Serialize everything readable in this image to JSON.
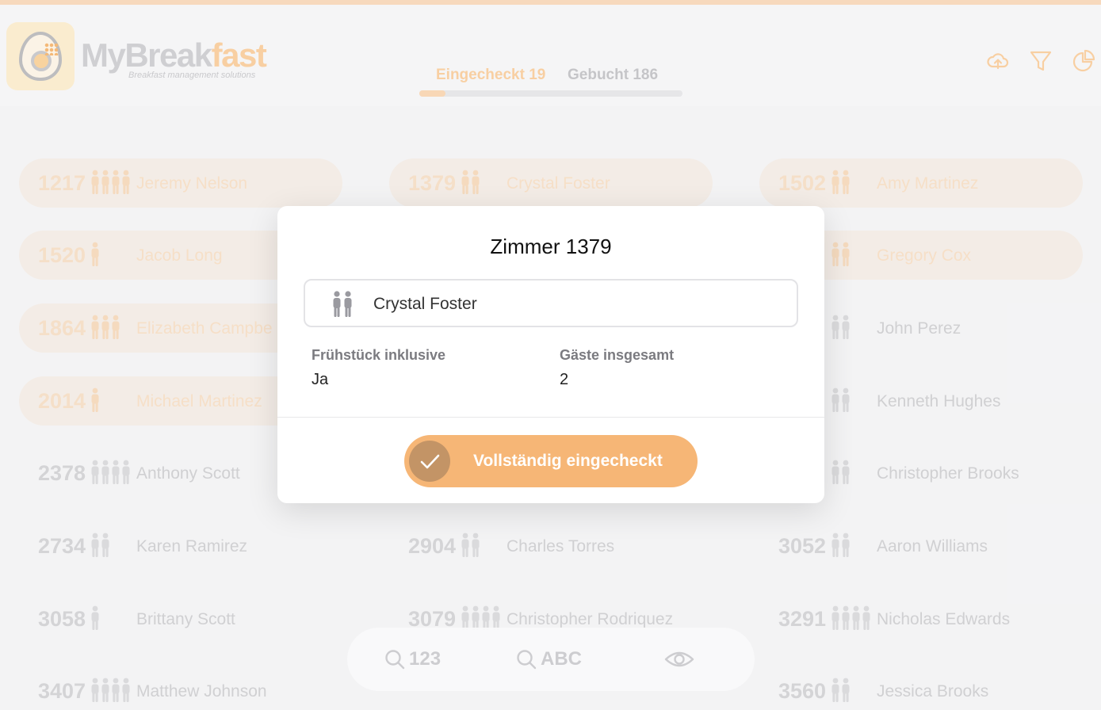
{
  "app": {
    "name_part1": "MyBreak",
    "name_part2": "fast",
    "tagline": "Breakfast management solutions"
  },
  "tabs": [
    {
      "label": "Eingecheckt",
      "count": "19",
      "active": true
    },
    {
      "label": "Gebucht",
      "count": "186",
      "active": false
    }
  ],
  "checkin_progress": 0.1,
  "header_icons": [
    "cloud-upload-icon",
    "filter-icon",
    "pie-chart-icon"
  ],
  "rooms": [
    {
      "number": "1217",
      "guests": 4,
      "name": "Jeremy Nelson",
      "checked_in": true
    },
    {
      "number": "1379",
      "guests": 2,
      "name": "Crystal Foster",
      "checked_in": true
    },
    {
      "number": "1502",
      "guests": 2,
      "name": "Amy Martinez",
      "checked_in": true
    },
    {
      "number": "1520",
      "guests": 1,
      "name": "Jacob Long",
      "checked_in": true
    },
    {
      "number": "",
      "guests": 2,
      "name": "Gregory Cox",
      "checked_in": true
    },
    {
      "number": "1864",
      "guests": 3,
      "name": "Elizabeth Campbe",
      "checked_in": true
    },
    {
      "number": "",
      "guests": 2,
      "name": "John Perez",
      "checked_in": false
    },
    {
      "number": "2014",
      "guests": 1,
      "name": "Michael Martinez",
      "checked_in": true
    },
    {
      "number": "",
      "guests": 2,
      "name": "Kenneth Hughes",
      "checked_in": false
    },
    {
      "number": "2378",
      "guests": 4,
      "name": "Anthony Scott",
      "checked_in": false
    },
    {
      "number": "",
      "guests": 2,
      "name": "Christopher Brooks",
      "checked_in": false
    },
    {
      "number": "2734",
      "guests": 2,
      "name": "Karen Ramirez",
      "checked_in": false
    },
    {
      "number": "2904",
      "guests": 2,
      "name": "Charles Torres",
      "checked_in": false
    },
    {
      "number": "3052",
      "guests": 2,
      "name": "Aaron Williams",
      "checked_in": false
    },
    {
      "number": "3058",
      "guests": 1,
      "name": "Brittany Scott",
      "checked_in": false
    },
    {
      "number": "3079",
      "guests": 4,
      "name": "Christopher Rodriquez",
      "checked_in": false
    },
    {
      "number": "3291",
      "guests": 4,
      "name": "Nicholas Edwards",
      "checked_in": false
    },
    {
      "number": "3407",
      "guests": 4,
      "name": "Matthew Johnson",
      "checked_in": false
    },
    {
      "number": "3560",
      "guests": 2,
      "name": "Jessica Brooks",
      "checked_in": false
    }
  ],
  "searchbar": {
    "number_search": "123",
    "alpha_search": "ABC",
    "view_icon": "eye-icon"
  },
  "modal": {
    "title": "Zimmer 1379",
    "guest_name": "Crystal Foster",
    "breakfast_label": "Frühstück inklusive",
    "breakfast_value": "Ja",
    "guests_label": "Gäste insgesamt",
    "guests_value": "2",
    "checkin_button": "Vollständig eingecheckt"
  },
  "colors": {
    "accent": "#f6b676",
    "accent_faded": "#f8cfa2",
    "knob": "#c39466"
  }
}
